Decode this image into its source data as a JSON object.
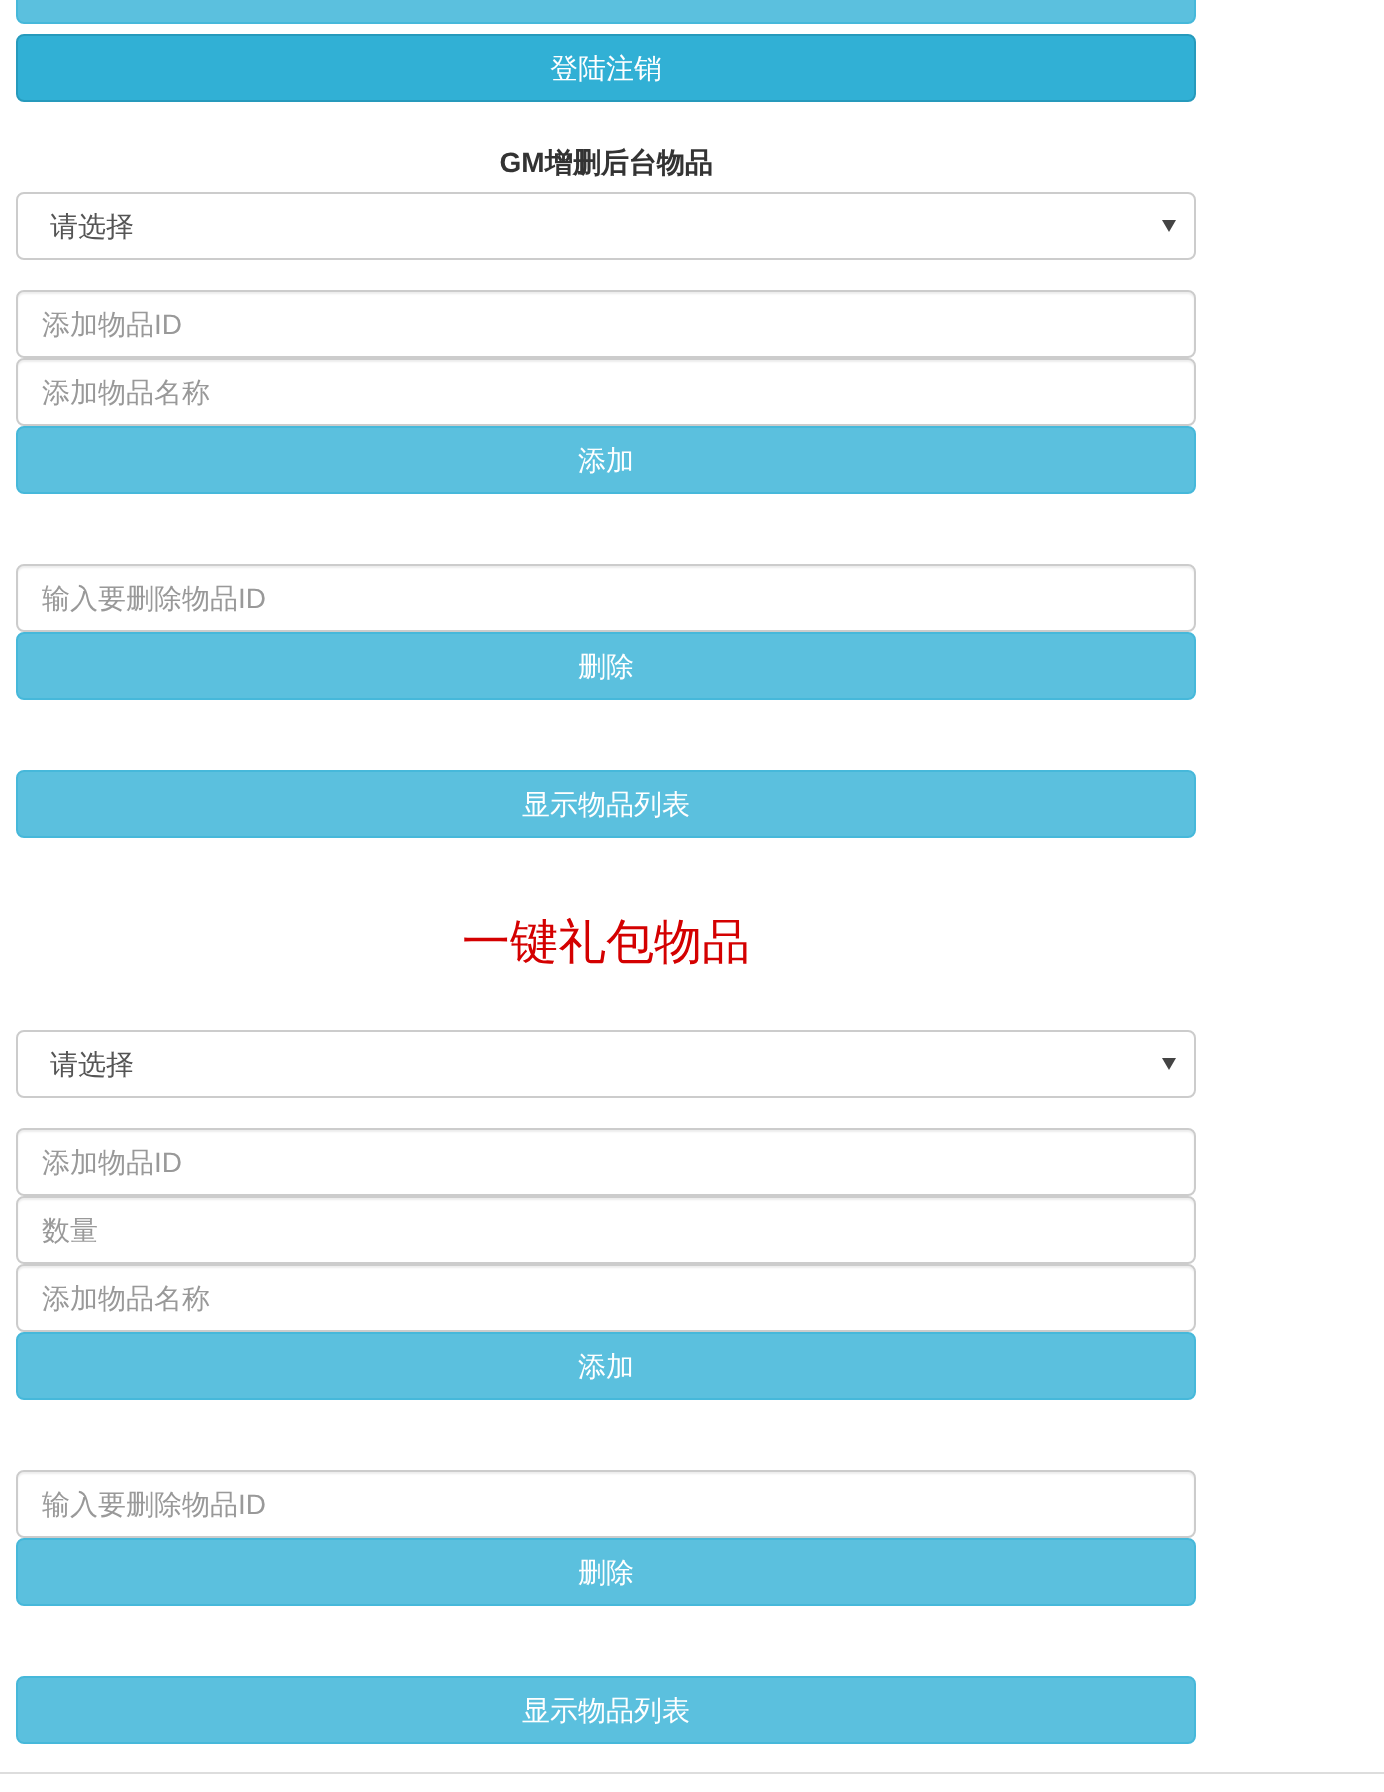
{
  "top_buttons": [
    {
      "active": false
    },
    {
      "label": "登陆注销",
      "active": true
    }
  ],
  "sections": [
    {
      "heading": {
        "text": "GM增删后台物品",
        "kind": "bold"
      },
      "select": {
        "value": "请选择"
      },
      "add_fields": [
        {
          "placeholder": "添加物品ID"
        },
        {
          "placeholder": "添加物品名称"
        }
      ],
      "add_button": {
        "label": "添加",
        "active": false
      },
      "delete_field": {
        "placeholder": "输入要删除物品ID"
      },
      "delete_button": {
        "label": "删除",
        "active": false
      },
      "list_button": {
        "label": "显示物品列表",
        "active": false
      }
    },
    {
      "heading": {
        "text": "一键礼包物品",
        "kind": "accent"
      },
      "select": {
        "value": "请选择"
      },
      "add_fields": [
        {
          "placeholder": "添加物品ID"
        },
        {
          "placeholder": "数量"
        },
        {
          "placeholder": "添加物品名称"
        }
      ],
      "add_button": {
        "label": "添加",
        "active": false
      },
      "delete_field": {
        "placeholder": "输入要删除物品ID"
      },
      "delete_button": {
        "label": "删除",
        "active": false
      },
      "list_button": {
        "label": "显示物品列表",
        "active": false
      }
    }
  ]
}
